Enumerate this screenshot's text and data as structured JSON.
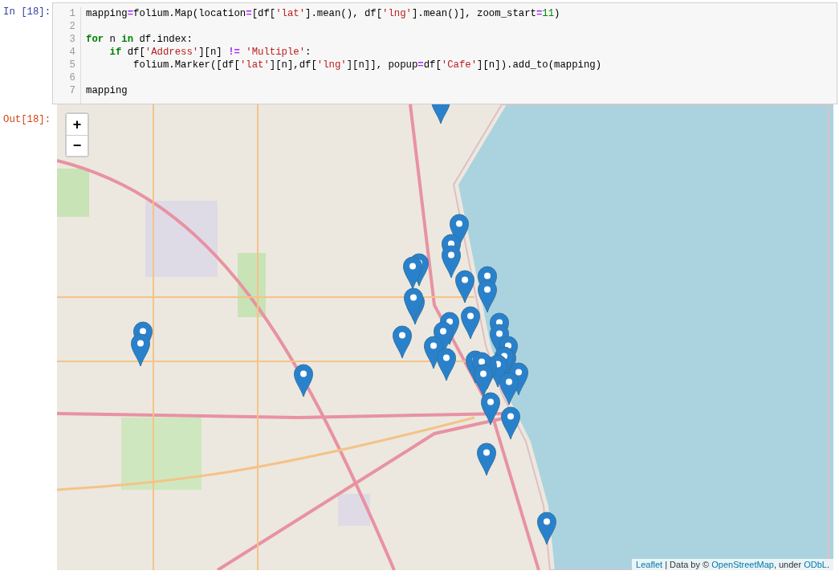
{
  "input_prompt": "In [18]:",
  "code_lines": [
    {
      "number": "1",
      "tokens": [
        {
          "kind": "name",
          "text": "mapping"
        },
        {
          "kind": "op",
          "text": "="
        },
        {
          "kind": "name",
          "text": "folium.Map(location"
        },
        {
          "kind": "op",
          "text": "="
        },
        {
          "kind": "name",
          "text": "[df["
        },
        {
          "kind": "str",
          "text": "'lat'"
        },
        {
          "kind": "name",
          "text": "].mean(), df["
        },
        {
          "kind": "str",
          "text": "'lng'"
        },
        {
          "kind": "name",
          "text": "].mean()], zoom_start"
        },
        {
          "kind": "op",
          "text": "="
        },
        {
          "kind": "num",
          "text": "11"
        },
        {
          "kind": "name",
          "text": ")"
        }
      ]
    },
    {
      "number": "2"
    },
    {
      "number": "3",
      "tokens": [
        {
          "kind": "kw",
          "text": "for"
        },
        {
          "kind": "name",
          "text": " n "
        },
        {
          "kind": "kw",
          "text": "in"
        },
        {
          "kind": "name",
          "text": " df.index:"
        }
      ]
    },
    {
      "number": "4",
      "tokens": [
        {
          "kind": "kw",
          "text": "    if"
        },
        {
          "kind": "name",
          "text": " df["
        },
        {
          "kind": "str",
          "text": "'Address'"
        },
        {
          "kind": "name",
          "text": "][n] "
        },
        {
          "kind": "op",
          "text": "!="
        },
        {
          "kind": "str",
          "text": " 'Multiple'"
        },
        {
          "kind": "name",
          "text": ":"
        }
      ]
    },
    {
      "number": "5",
      "tokens": [
        {
          "kind": "name",
          "text": "        folium.Marker([df["
        },
        {
          "kind": "str",
          "text": "'lat'"
        },
        {
          "kind": "name",
          "text": "][n],df["
        },
        {
          "kind": "str",
          "text": "'lng'"
        },
        {
          "kind": "name",
          "text": "][n]], popup"
        },
        {
          "kind": "op",
          "text": "="
        },
        {
          "kind": "name",
          "text": "df["
        },
        {
          "kind": "str",
          "text": "'Cafe'"
        },
        {
          "kind": "name",
          "text": "][n]).add_to(mapping)"
        }
      ]
    },
    {
      "number": "6"
    },
    {
      "number": "7",
      "tokens": [
        {
          "kind": "name",
          "text": "mapping"
        }
      ]
    }
  ],
  "output_prompt": "Out[18]:",
  "map": {
    "kind": "picture",
    "zoom_buttons": [
      "+",
      "−"
    ],
    "attribution": [
      {
        "kind": "link",
        "text": "Leaflet"
      },
      {
        "kind": "text",
        "text": " | Data by © "
      },
      {
        "kind": "link",
        "text": "OpenStreetMap"
      },
      {
        "kind": "text",
        "text": ", under "
      },
      {
        "kind": "link",
        "text": "ODbL"
      },
      {
        "kind": "text",
        "text": "."
      }
    ]
  }
}
